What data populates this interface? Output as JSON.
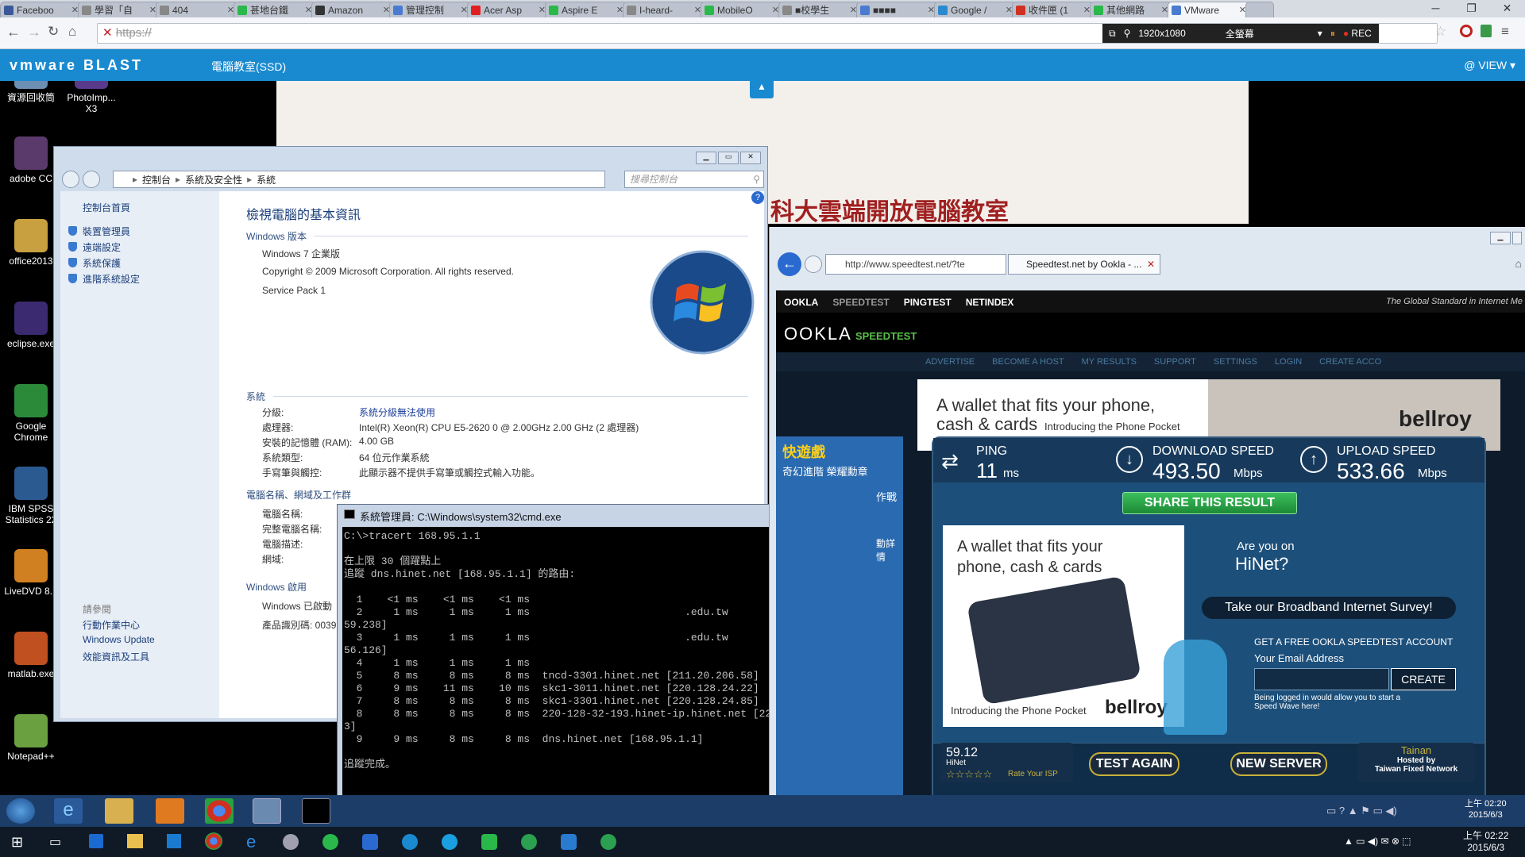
{
  "browser": {
    "tabs": [
      {
        "label": "Faceboo",
        "icon": "facebook-icon",
        "color": "#3b5998"
      },
      {
        "label": "學習「自",
        "icon": "page-icon",
        "color": "#888888"
      },
      {
        "label": "404",
        "icon": "page-icon",
        "color": "#888888"
      },
      {
        "label": "甚地台鐵",
        "icon": "line-icon",
        "color": "#2ab84a"
      },
      {
        "label": "Amazon",
        "icon": "cloud-icon",
        "color": "#333333"
      },
      {
        "label": "管理控制",
        "icon": "settings-icon",
        "color": "#4a7bd0"
      },
      {
        "label": "Acer Asp",
        "icon": "youtube-icon",
        "color": "#e02020"
      },
      {
        "label": "Aspire E",
        "icon": "leaf-icon",
        "color": "#2ab84a"
      },
      {
        "label": "I-heard-",
        "icon": "page-icon",
        "color": "#888888"
      },
      {
        "label": "MobileO",
        "icon": "line-icon",
        "color": "#2ab84a"
      },
      {
        "label": "■校學生",
        "icon": "page-icon",
        "color": "#888888"
      },
      {
        "label": "■■■■",
        "icon": "google-icon",
        "color": "#4a7bd0"
      },
      {
        "label": "Google /",
        "icon": "play-icon",
        "color": "#2a8ad0"
      },
      {
        "label": "收件匣 (1",
        "icon": "gmail-icon",
        "color": "#d03020"
      },
      {
        "label": "其他網路",
        "icon": "line-icon",
        "color": "#2ab84a"
      },
      {
        "label": "VMware",
        "icon": "vmware-icon",
        "color": "#4a7bd0"
      }
    ],
    "url": "https://",
    "recorder": {
      "resolution": "1920x1080",
      "mode": "全螢幕",
      "rec": "REC"
    }
  },
  "vmware": {
    "brand": "vmware BLAST",
    "session": "電腦教室(SSD)",
    "view": "@ VIEW"
  },
  "remote": {
    "desktop_icons": [
      {
        "label": "資源回收筒",
        "color": "#6d8fb3"
      },
      {
        "label": "PhotoImp...\nX3",
        "color": "#5a3a8a"
      },
      {
        "label": "adobe CC",
        "color": "#5a3a6a"
      },
      {
        "label": "office2013",
        "color": "#c8a040"
      },
      {
        "label": "eclipse.exe",
        "color": "#3b2a70"
      },
      {
        "label": "Google\nChrome",
        "color": "#2a8a3a"
      },
      {
        "label": "IBM SPSS\nStatistics 22",
        "color": "#2a5a90"
      },
      {
        "label": "LiveDVD 8...",
        "color": "#d08020"
      },
      {
        "label": "matlab.exe",
        "color": "#c05020"
      },
      {
        "label": "Notepad++",
        "color": "#6aa040"
      }
    ],
    "background_title": "科大雲端開放電腦教室",
    "control_panel": {
      "breadcrumb": [
        "控制台",
        "系統及安全性",
        "系統"
      ],
      "search_placeholder": "搜尋控制台",
      "side_home": "控制台首頁",
      "side_links": [
        "裝置管理員",
        "遠端設定",
        "系統保護",
        "進階系統設定"
      ],
      "see_also_title": "請參閱",
      "see_also": [
        "行動作業中心",
        "Windows Update",
        "效能資訊及工具"
      ],
      "title": "檢視電腦的基本資訊",
      "edition_header": "Windows 版本",
      "edition": "Windows 7 企業版",
      "copyright": "Copyright © 2009 Microsoft Corporation.  All rights reserved.",
      "service_pack": "Service Pack 1",
      "system_header": "系統",
      "system_rows": [
        {
          "label": "分級:",
          "value": "系統分級無法使用",
          "link": true
        },
        {
          "label": "處理器:",
          "value": "Intel(R) Xeon(R) CPU E5-2620 0 @ 2.00GHz  2.00 GHz (2 處理器)",
          "link": false
        },
        {
          "label": "安裝的記憶體 (RAM):",
          "value": "4.00 GB",
          "link": false
        },
        {
          "label": "系統類型:",
          "value": "64 位元作業系統",
          "link": false
        },
        {
          "label": "手寫筆與觸控:",
          "value": "此顯示器不提供手寫筆或觸控式輸入功能。",
          "link": false
        }
      ],
      "network_header": "電腦名稱、網域及工作群",
      "network_rows": [
        "電腦名稱:",
        "完整電腦名稱:",
        "電腦描述:",
        "網域:"
      ],
      "activation_header": "Windows 啟用",
      "activation_rows": [
        "Windows 已啟動",
        "產品識別碼: 00392-"
      ]
    },
    "cmd": {
      "title": "系統管理員: C:\\Windows\\system32\\cmd.exe",
      "lines": [
        "C:\\>tracert 168.95.1.1",
        "",
        "在上限 30 個躍點上",
        "追蹤 dns.hinet.net [168.95.1.1] 的路由:",
        "",
        "  1    <1 ms    <1 ms    <1 ms  ",
        "  2     1 ms     1 ms     1 ms                         .edu.tw",
        "59.238]",
        "  3     1 ms     1 ms     1 ms                         .edu.tw",
        "56.126]",
        "  4     1 ms     1 ms     1 ms  ",
        "  5     8 ms     8 ms     8 ms  tncd-3301.hinet.net [211.20.206.58]",
        "  6     9 ms    11 ms    10 ms  skc1-3011.hinet.net [220.128.24.22]",
        "  7     8 ms     8 ms     8 ms  skc1-3301.hinet.net [220.128.24.85]",
        "  8     8 ms     8 ms     8 ms  220-128-32-193.hinet-ip.hinet.net [220.128.32.19",
        "3]",
        "  9     9 ms     8 ms     8 ms  dns.hinet.net [168.95.1.1]",
        "",
        "追蹤完成。"
      ]
    },
    "ie": {
      "url": "http://www.speedtest.net/?te",
      "tab": "Speedtest.net by Ookla - ...",
      "nav": [
        "OOKLA",
        "SPEEDTEST",
        "PINGTEST",
        "NETINDEX"
      ],
      "tagline": "The Global Standard in Internet Me",
      "logo": "OOKLA",
      "logo_sub": "SPEEDTEST",
      "menu": [
        "ADVERTISE",
        "BECOME A HOST",
        "MY RESULTS",
        "SUPPORT",
        "SETTINGS",
        "LOGIN",
        "CREATE ACCO"
      ],
      "ad_top": {
        "line1": "A wallet that fits your phone,",
        "line2": "cash & cards",
        "sub": "Introducing the Phone Pocket",
        "brand": "bellroy"
      },
      "side_ad": {
        "title": "快遊戲",
        "line": "奇幻進階  榮耀勳章",
        "more": "動詳情",
        "right": "作戰"
      },
      "ping": {
        "label": "PING",
        "value": "11",
        "unit": "ms"
      },
      "download": {
        "label": "DOWNLOAD SPEED",
        "value": "493.50",
        "unit": "Mbps"
      },
      "upload": {
        "label": "UPLOAD SPEED",
        "value": "533.66",
        "unit": "Mbps"
      },
      "share": "SHARE THIS RESULT",
      "ad_mid": {
        "line1": "A wallet that fits your",
        "line2": "phone, cash & cards",
        "sub": "Introducing the Phone Pocket",
        "brand": "bellroy"
      },
      "hinet": {
        "q1": "Are you on",
        "q2": "HiNet?",
        "survey": "Take our Broadband Internet Survey!"
      },
      "account": {
        "title": "GET A FREE OOKLA SPEEDTEST ACCOUNT",
        "email_label": "Your Email Address",
        "create": "CREATE",
        "note": "Being logged in would allow you to start a Speed Wave here!"
      },
      "footer": {
        "isp_score": "59.12",
        "isp_name": "HiNet",
        "rate": "Rate Your ISP",
        "again": "TEST AGAIN",
        "new_server": "NEW SERVER",
        "city": "Tainan",
        "hosted_by": "Hosted by",
        "host": "Taiwan Fixed Network"
      }
    },
    "taskbar_clock": {
      "time": "上午 02:20",
      "date": "2015/6/3"
    }
  },
  "host_taskbar_clock": {
    "time": "上午 02:22",
    "date": "2015/6/3"
  }
}
